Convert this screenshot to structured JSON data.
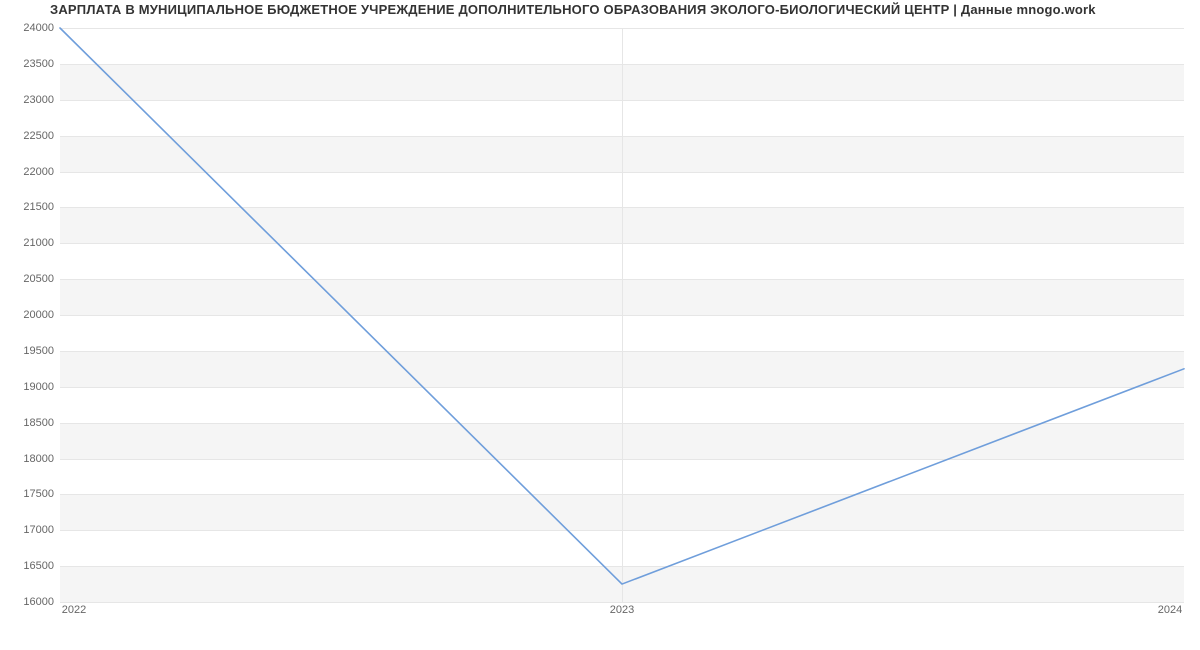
{
  "chart_data": {
    "type": "line",
    "title": "ЗАРПЛАТА В МУНИЦИПАЛЬНОЕ БЮДЖЕТНОЕ УЧРЕЖДЕНИЕ ДОПОЛНИТЕЛЬНОГО ОБРАЗОВАНИЯ ЭКОЛОГО-БИОЛОГИЧЕСКИЙ ЦЕНТР | Данные mnogo.work",
    "xlabel": "",
    "ylabel": "",
    "x": [
      "2022",
      "2023",
      "2024"
    ],
    "values": [
      24000,
      16250,
      19250
    ],
    "ylim": [
      16000,
      24000
    ],
    "yticks": [
      16000,
      16500,
      17000,
      17500,
      18000,
      18500,
      19000,
      19500,
      20000,
      20500,
      21000,
      21500,
      22000,
      22500,
      23000,
      23500,
      24000
    ],
    "xticks": [
      "2022",
      "2023",
      "2024"
    ],
    "line_color": "#6f9edb"
  }
}
